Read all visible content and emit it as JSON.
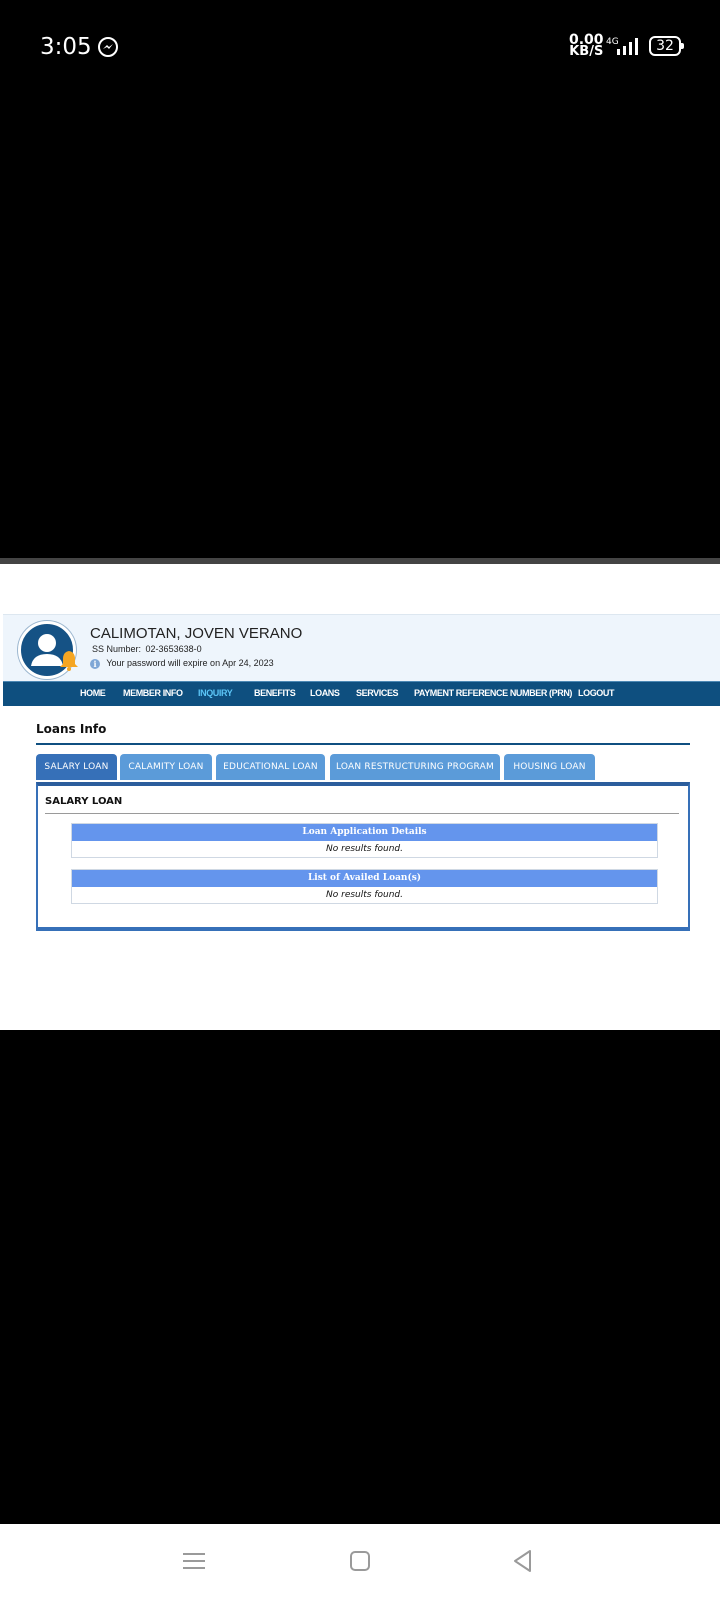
{
  "status_bar": {
    "time": "3:05",
    "speed_value": "0.00",
    "speed_unit": "KB/S",
    "network": "4G",
    "battery": "32",
    "icons": [
      "messenger-icon",
      "signal-icon",
      "battery-icon"
    ]
  },
  "profile": {
    "name": "CALIMOTAN, JOVEN VERANO",
    "ss_number_label": "SS Number:",
    "ss_number": "02-3653638-0",
    "password_notice": "Your password will expire on Apr 24, 2023",
    "icons": [
      "avatar-icon",
      "bell-icon",
      "info-icon"
    ]
  },
  "nav": {
    "items": [
      "HOME",
      "MEMBER INFO",
      "INQUIRY",
      "BENEFITS",
      "LOANS",
      "SERVICES",
      "PAYMENT REFERENCE NUMBER (PRN)",
      "LOGOUT"
    ],
    "active": "INQUIRY",
    "active_color": "#5bc4f5",
    "bar_color": "#0e4f7f"
  },
  "loans": {
    "section_title": "Loans Info",
    "tabs": [
      "SALARY LOAN",
      "CALAMITY LOAN",
      "EDUCATIONAL LOAN",
      "LOAN RESTRUCTURING PROGRAM",
      "HOUSING LOAN"
    ],
    "active_tab": "SALARY LOAN",
    "panel_title": "SALARY LOAN",
    "tables": [
      {
        "header": "Loan Application Details",
        "message": "No results found."
      },
      {
        "header": "List of Availed Loan(s)",
        "message": "No results found."
      }
    ],
    "header_color": "#6495ed"
  },
  "system_nav": {
    "icons": [
      "menu-icon",
      "home-icon",
      "back-icon"
    ]
  }
}
